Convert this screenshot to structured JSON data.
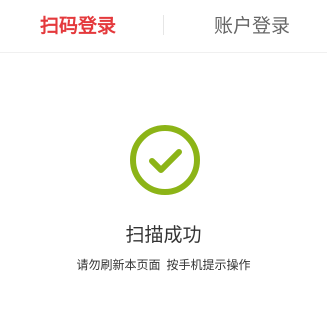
{
  "tabs": {
    "qr_login": "扫码登录",
    "account_login": "账户登录",
    "active": "qr_login"
  },
  "status": {
    "icon": "checkmark-circle-icon",
    "icon_color": "#8cb417",
    "title": "扫描成功",
    "hint_refresh": "请勿刷新本页面",
    "hint_confirm": "按手机提示操作"
  },
  "colors": {
    "accent": "#e4393c",
    "text_primary": "#333333",
    "text_secondary": "#666666"
  }
}
